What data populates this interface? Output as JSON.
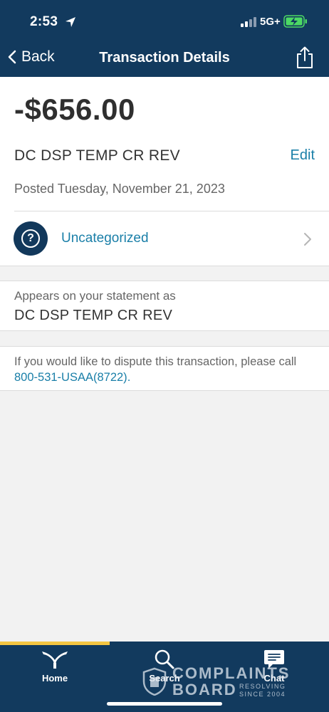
{
  "status_bar": {
    "time": "2:53",
    "network": "5G+",
    "icons": [
      "location-arrow-icon",
      "signal-icon",
      "battery-charging-icon"
    ]
  },
  "nav": {
    "back_label": "Back",
    "title": "Transaction Details",
    "share_icon": "share-icon"
  },
  "transaction": {
    "amount": "-$656.00",
    "merchant": "DC DSP TEMP CR REV",
    "edit_label": "Edit",
    "posted": "Posted Tuesday, November 21, 2023",
    "category": "Uncategorized",
    "category_icon": "question-mark-icon"
  },
  "statement": {
    "label": "Appears on your statement as",
    "value": "DC DSP TEMP CR REV"
  },
  "dispute": {
    "text": "If you would like to dispute this transaction, please call ",
    "phone": "800-531-USAA(8722)",
    "suffix": "."
  },
  "tabs": [
    {
      "label": "Home",
      "icon": "usaa-eagle-icon",
      "active": true
    },
    {
      "label": "Search",
      "icon": "search-icon",
      "active": false
    },
    {
      "label": "Chat",
      "icon": "chat-icon",
      "active": false
    }
  ],
  "watermark": {
    "line1": "COMPLAINTS",
    "line2": "BOARD",
    "sub1": "RESOLVING",
    "sub2": "SINCE 2004"
  },
  "colors": {
    "header_bg": "#123a5e",
    "link": "#1a7fa8",
    "active_tab_indicator": "#f4c542",
    "battery_green": "#4cd964"
  }
}
